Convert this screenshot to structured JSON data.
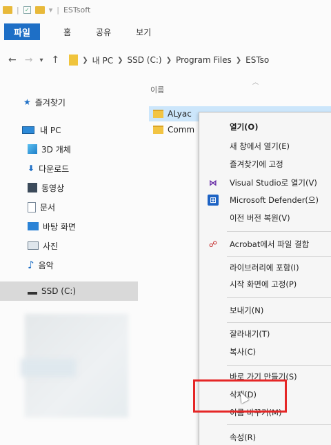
{
  "window": {
    "title": "ESTsoft"
  },
  "ribbon": {
    "file_tab": "파일",
    "tabs": [
      "홈",
      "공유",
      "보기"
    ]
  },
  "address": {
    "crumbs": [
      "내 PC",
      "SSD (C:)",
      "Program Files",
      "ESTso"
    ]
  },
  "nav_pane": {
    "items": [
      {
        "label": "즐겨찾기",
        "icon": "star-icon"
      },
      {
        "label": "내 PC",
        "icon": "computer-icon"
      },
      {
        "label": "3D 개체",
        "icon": "cube-icon"
      },
      {
        "label": "다운로드",
        "icon": "download-icon"
      },
      {
        "label": "동영상",
        "icon": "video-icon"
      },
      {
        "label": "문서",
        "icon": "document-icon"
      },
      {
        "label": "바탕 화면",
        "icon": "desktop-icon"
      },
      {
        "label": "사진",
        "icon": "picture-icon"
      },
      {
        "label": "음악",
        "icon": "music-icon"
      },
      {
        "label": "SSD (C:)",
        "icon": "drive-icon"
      }
    ]
  },
  "file_list": {
    "column_name": "이름",
    "rows": [
      {
        "name": "ALyac"
      },
      {
        "name": "Comm"
      }
    ]
  },
  "context_menu": {
    "items": [
      {
        "label": "열기(O)"
      },
      {
        "label": "새 창에서 열기(E)"
      },
      {
        "label": "즐겨찾기에 고정"
      },
      {
        "label": "Visual Studio로 열기(V)",
        "icon": "visual-studio-icon"
      },
      {
        "label": "Microsoft Defender(으)",
        "icon": "defender-icon"
      },
      {
        "label": "이전 버전 복원(V)"
      },
      {
        "label": "Acrobat에서 파일 결합",
        "icon": "acrobat-icon"
      },
      {
        "label": "라이브러리에 포함(I)"
      },
      {
        "label": "시작 화면에 고정(P)"
      },
      {
        "label": "보내기(N)"
      },
      {
        "label": "잘라내기(T)"
      },
      {
        "label": "복사(C)"
      },
      {
        "label": "바로 가기 만들기(S)"
      },
      {
        "label": "삭제(D)"
      },
      {
        "label": "이름 바꾸기(M)"
      },
      {
        "label": "속성(R)"
      }
    ]
  },
  "colors": {
    "accent": "#1e6fc6",
    "highlight": "#e52727",
    "selection": "#cce6fb",
    "folder": "#f2c443"
  }
}
